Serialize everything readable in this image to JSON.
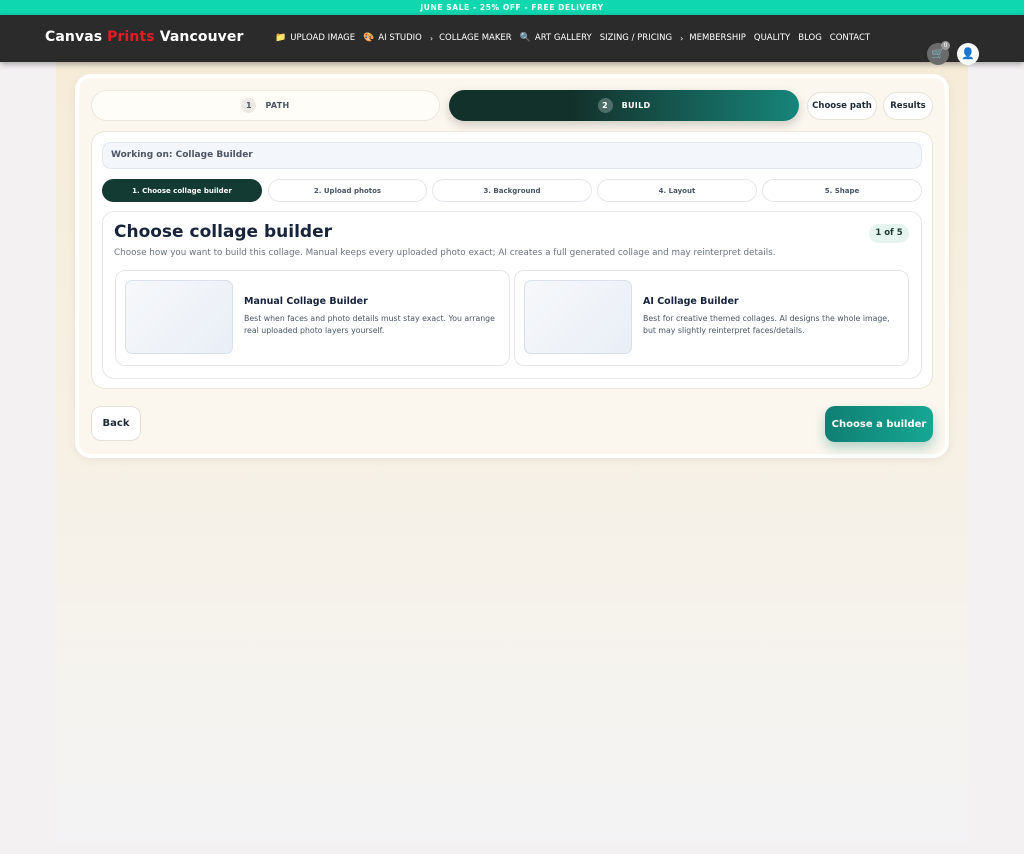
{
  "promo": {
    "text": "JUNE SALE - 25% OFF - FREE DELIVERY"
  },
  "brand": {
    "part1": "Canvas ",
    "part2": "Prints",
    "part3": " Vancouver"
  },
  "nav": {
    "items": [
      {
        "label": "UPLOAD IMAGE",
        "icon": "folder-icon"
      },
      {
        "label": "AI STUDIO",
        "icon": "palette-icon",
        "chevron": true
      },
      {
        "label": "COLLAGE MAKER"
      },
      {
        "label": "ART GALLERY",
        "icon": "magnifier-icon"
      },
      {
        "label": "SIZING / PRICING",
        "chevron": true
      },
      {
        "label": "MEMBERSHIP"
      },
      {
        "label": "QUALITY"
      },
      {
        "label": "BLOG"
      },
      {
        "label": "CONTACT"
      }
    ],
    "cart_count": "0"
  },
  "steps": {
    "path": {
      "num": "1",
      "label": "PATH"
    },
    "build": {
      "num": "2",
      "label": "BUILD"
    },
    "choose_path": "Choose path",
    "results": "Results"
  },
  "working_on": "Working on: Collage Builder",
  "sub_steps": [
    "1. Choose collage builder",
    "2. Upload photos",
    "3. Background",
    "4. Layout",
    "5. Shape"
  ],
  "content": {
    "title": "Choose collage builder",
    "counter": "1 of 5",
    "description": "Choose how you want to build this collage. Manual keeps every uploaded photo exact; AI creates a full generated collage and may reinterpret details."
  },
  "options": [
    {
      "title": "Manual Collage Builder",
      "desc": "Best when faces and photo details must stay exact. You arrange real uploaded photo layers yourself."
    },
    {
      "title": "AI Collage Builder",
      "desc": "Best for creative themed collages. AI designs the whole image, but may slightly reinterpret faces/details."
    }
  ],
  "actions": {
    "back": "Back",
    "choose": "Choose a builder"
  }
}
